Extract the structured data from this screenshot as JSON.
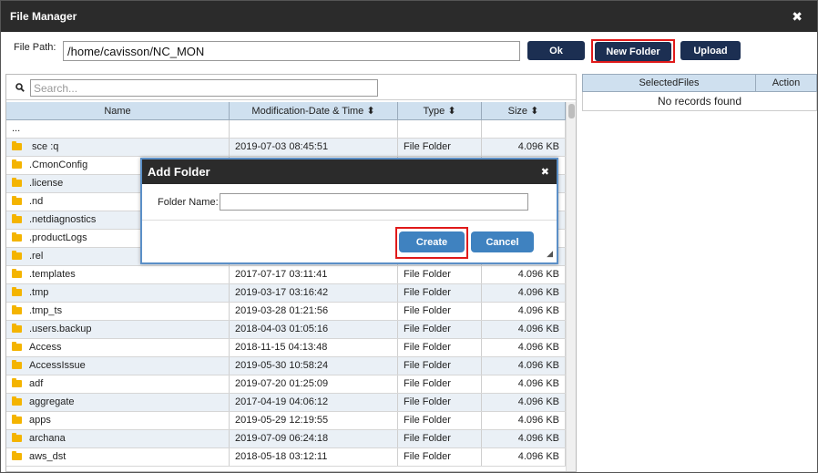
{
  "window": {
    "title": "File Manager",
    "close_glyph": "✖"
  },
  "pathbar": {
    "label": "File Path:",
    "path_value": "/home/cavisson/NC_MON",
    "ok_label": "Ok",
    "new_folder_label": "New Folder",
    "upload_label": "Upload"
  },
  "search": {
    "placeholder": "Search...",
    "icon": "search-icon"
  },
  "grid": {
    "columns": {
      "name": "Name",
      "date": "Modification-Date & Time ⬍",
      "type": "Type ⬍",
      "size": "Size ⬍"
    },
    "parent_row": "...",
    "rows": [
      {
        "name": " sce :q",
        "date": "2019-07-03 08:45:51",
        "type": "File Folder",
        "size": "4.096 KB"
      },
      {
        "name": ".CmonConfig",
        "date": "",
        "type": "",
        "size": ""
      },
      {
        "name": ".license",
        "date": "",
        "type": "",
        "size": ""
      },
      {
        "name": ".nd",
        "date": "",
        "type": "",
        "size": ""
      },
      {
        "name": ".netdiagnostics",
        "date": "",
        "type": "",
        "size": ""
      },
      {
        "name": ".productLogs",
        "date": "",
        "type": "",
        "size": ""
      },
      {
        "name": ".rel",
        "date": "",
        "type": "",
        "size": ""
      },
      {
        "name": ".templates",
        "date": "2017-07-17 03:11:41",
        "type": "File Folder",
        "size": "4.096 KB"
      },
      {
        "name": ".tmp",
        "date": "2019-03-17 03:16:42",
        "type": "File Folder",
        "size": "4.096 KB"
      },
      {
        "name": ".tmp_ts",
        "date": "2019-03-28 01:21:56",
        "type": "File Folder",
        "size": "4.096 KB"
      },
      {
        "name": ".users.backup",
        "date": "2018-04-03 01:05:16",
        "type": "File Folder",
        "size": "4.096 KB"
      },
      {
        "name": "Access",
        "date": "2018-11-15 04:13:48",
        "type": "File Folder",
        "size": "4.096 KB"
      },
      {
        "name": "AccessIssue",
        "date": "2019-05-30 10:58:24",
        "type": "File Folder",
        "size": "4.096 KB"
      },
      {
        "name": "adf",
        "date": "2019-07-20 01:25:09",
        "type": "File Folder",
        "size": "4.096 KB"
      },
      {
        "name": "aggregate",
        "date": "2017-04-19 04:06:12",
        "type": "File Folder",
        "size": "4.096 KB"
      },
      {
        "name": "apps",
        "date": "2019-05-29 12:19:55",
        "type": "File Folder",
        "size": "4.096 KB"
      },
      {
        "name": "archana",
        "date": "2019-07-09 06:24:18",
        "type": "File Folder",
        "size": "4.096 KB"
      },
      {
        "name": "aws_dst",
        "date": "2018-05-18 03:12:11",
        "type": "File Folder",
        "size": "4.096 KB"
      }
    ]
  },
  "selected_files": {
    "col_files": "SelectedFiles",
    "col_action": "Action",
    "empty_text": "No records found"
  },
  "modal": {
    "title": "Add Folder",
    "close_glyph": "✖",
    "field_label": "Folder Name:",
    "field_value": "",
    "create_label": "Create",
    "cancel_label": "Cancel",
    "resize_glyph": "◢"
  },
  "colors": {
    "titlebar": "#2b2b2b",
    "dark_button": "#1c2f52",
    "blue_button": "#3f82c0",
    "highlight": "#e01a1a",
    "folder": "#f4b400"
  }
}
